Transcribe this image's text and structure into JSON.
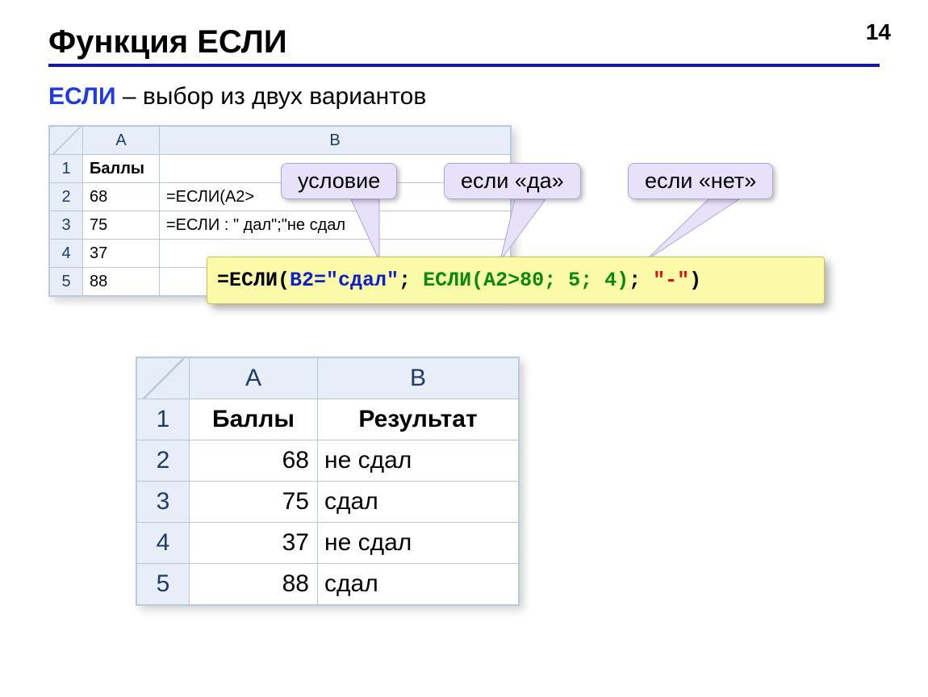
{
  "page_number": "14",
  "title": "Функция ЕСЛИ",
  "subtitle_keyword": "ЕСЛИ",
  "subtitle_rest": " – выбор из двух вариантов",
  "callouts": {
    "condition": "условие",
    "if_yes": "если «да»",
    "if_no": "если «нет»"
  },
  "top_table": {
    "cols": {
      "A": "A",
      "B": "B"
    },
    "header_row": {
      "A": "Баллы",
      "B": ""
    },
    "rows": [
      {
        "num": "1"
      },
      {
        "num": "2",
        "A": "68",
        "B": "=ЕСЛИ(A2>"
      },
      {
        "num": "3",
        "A": "75",
        "B": "=ЕСЛИ        : \" дал\";\"не сдал"
      },
      {
        "num": "4",
        "A": "37",
        "B": ""
      },
      {
        "num": "5",
        "A": "88",
        "B": ""
      }
    ]
  },
  "formula": {
    "p1": "=ЕСЛИ(",
    "cond": "B2=\"сдал\"",
    "sep1": "; ",
    "yes": "ЕСЛИ(A2>80; 5; 4)",
    "sep2": "; ",
    "no": "\"-\"",
    "close": ")"
  },
  "bottom_table": {
    "cols": {
      "A": "A",
      "B": "B"
    },
    "header_row": {
      "A": "Баллы",
      "B": "Результат"
    },
    "rows": [
      {
        "num": "1"
      },
      {
        "num": "2",
        "A": "68",
        "B": "не сдал"
      },
      {
        "num": "3",
        "A": "75",
        "B": "сдал"
      },
      {
        "num": "4",
        "A": "37",
        "B": "не сдал"
      },
      {
        "num": "5",
        "A": "88",
        "B": "сдал"
      }
    ]
  }
}
